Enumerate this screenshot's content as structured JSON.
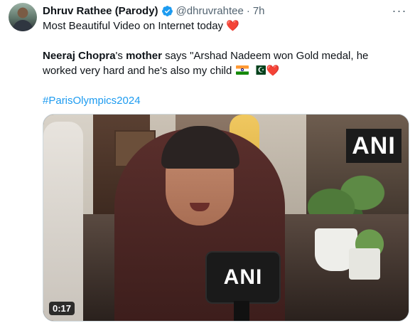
{
  "author": {
    "name": "Dhruv Rathee (Parody)",
    "handle": "@dhruvrahtee",
    "separator": "·",
    "time": "7h",
    "verified_icon": "verified-badge-icon",
    "avatar_icon": "profile-avatar"
  },
  "more_label": "···",
  "tweet": {
    "line1_text": "Most Beautiful Video on Internet today ",
    "line1_emoji": "❤️",
    "quote_name": "Neeraj Chopra",
    "quote_possessive": "'s ",
    "quote_mother": "mother",
    "quote_body": " says \"Arshad Nadeem won Gold medal, he worked very hard and he's also my child ",
    "quote_flags": [
      "flag-india",
      "flag-pakistan"
    ],
    "quote_heart": "❤️",
    "hashtag": "#ParisOlympics2024"
  },
  "video": {
    "watermark": "ANI",
    "mic_label": "ANI",
    "duration": "0:17"
  },
  "colors": {
    "text": "#0f1419",
    "secondary": "#536471",
    "link": "#1d9bf0",
    "verified": "#1d9bf0",
    "heart": "#e0245e"
  }
}
